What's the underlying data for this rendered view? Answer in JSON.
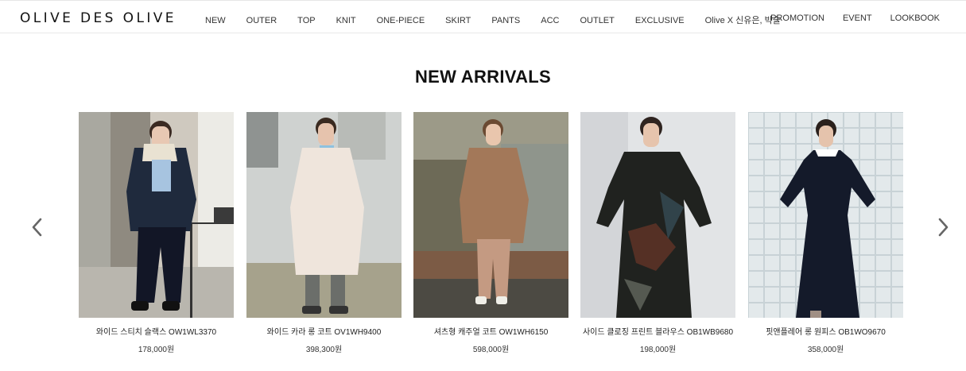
{
  "header": {
    "logo": "OLIVE DES OLIVE",
    "nav_left": [
      "NEW",
      "OUTER",
      "TOP",
      "KNIT",
      "ONE-PIECE",
      "SKIRT",
      "PANTS",
      "ACC",
      "OUTLET",
      "EXCLUSIVE",
      "Olive X 신유은, 박슬"
    ],
    "nav_right": [
      "PROMOTION",
      "EVENT",
      "LOOKBOOK"
    ]
  },
  "section": {
    "title": "NEW ARRIVALS"
  },
  "carousel": {
    "prev_icon": "chevron-left-icon",
    "next_icon": "chevron-right-icon",
    "products": [
      {
        "name": "와이드 스티치 슬랙스 OW1WL3370",
        "price": "178,000원",
        "photo": "model in navy padded jacket and wide navy slacks"
      },
      {
        "name": "와이드 카라 롱 코트 OV1WH9400",
        "price": "398,300원",
        "photo": "model in cream long coat"
      },
      {
        "name": "셔츠형 캐주얼 코트 OW1WH6150",
        "price": "598,000원",
        "photo": "model in brown check coat"
      },
      {
        "name": "사이드 클로징 프린트 블라우스 OB1WB9680",
        "price": "198,000원",
        "photo": "model in dark printed dress"
      },
      {
        "name": "핏앤플레어 롱 원피스 OB1WO9670",
        "price": "358,000원",
        "photo": "model in navy long dress"
      }
    ]
  },
  "colors": {
    "text": "#222222",
    "border": "#e8e8e8",
    "arrow": "#666666"
  }
}
